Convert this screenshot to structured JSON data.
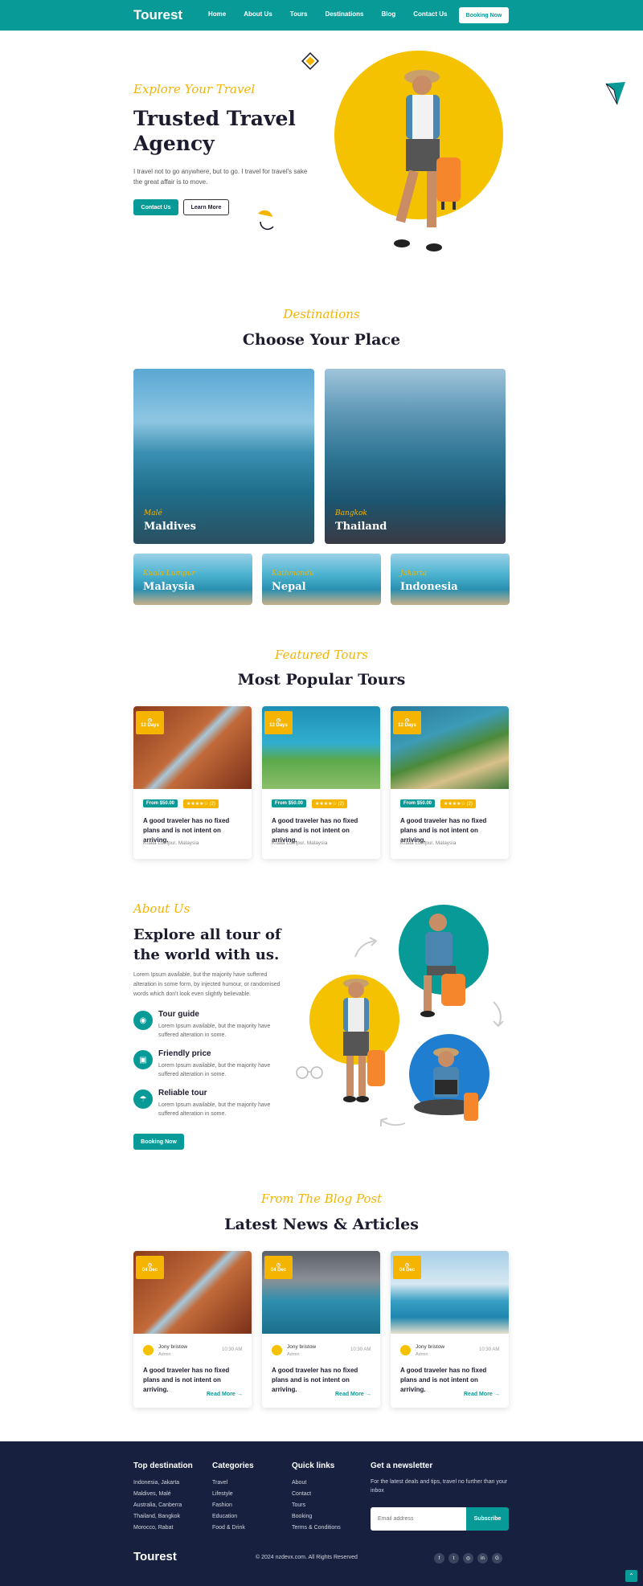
{
  "header": {
    "logo": "Tourest",
    "nav": [
      "Home",
      "About Us",
      "Tours",
      "Destinations",
      "Blog",
      "Contact Us"
    ],
    "cta": "Booking Now"
  },
  "hero": {
    "tagline": "Explore Your Travel",
    "title": "Trusted Travel Agency",
    "description": "I travel not to go anywhere, but to go. I travel for travel's sake the great affair is to move.",
    "btn_primary": "Contact Us",
    "btn_secondary": "Learn More"
  },
  "destinations": {
    "tagline": "Destinations",
    "title": "Choose Your Place",
    "items": [
      {
        "sub": "Malé",
        "name": "Maldives"
      },
      {
        "sub": "Bangkok",
        "name": "Thailand"
      },
      {
        "sub": "Kuala Lumpur",
        "name": "Malaysia"
      },
      {
        "sub": "Kathmandu",
        "name": "Nepal"
      },
      {
        "sub": "Jakarta",
        "name": "Indonesia"
      }
    ]
  },
  "tours": {
    "tagline": "Featured Tours",
    "title": "Most Popular Tours",
    "items": [
      {
        "days": "12 Days",
        "price": "From $50.00",
        "rating": "★★★★☆ (2)",
        "title": "A good traveler has no fixed plans and is not intent on arriving.",
        "location": "Kuala Lumpur, Malaysia"
      },
      {
        "days": "12 Days",
        "price": "From $50.00",
        "rating": "★★★★☆ (2)",
        "title": "A good traveler has no fixed plans and is not intent on arriving.",
        "location": "Kuala Lumpur, Malaysia"
      },
      {
        "days": "12 Days",
        "price": "From $50.00",
        "rating": "★★★★☆ (2)",
        "title": "A good traveler has no fixed plans and is not intent on arriving.",
        "location": "Kuala Lumpur, Malaysia"
      }
    ]
  },
  "about": {
    "tagline": "About Us",
    "title": "Explore all tour of the world with us.",
    "description": "Lorem Ipsum available, but the majority have suffered alteration in some form, by injected humour, or randomised words which don't look even slightly believable.",
    "features": [
      {
        "icon": "compass-icon",
        "title": "Tour guide",
        "desc": "Lorem Ipsum available, but the majority have suffered alteration in some."
      },
      {
        "icon": "briefcase-icon",
        "title": "Friendly price",
        "desc": "Lorem Ipsum available, but the majority have suffered alteration in some."
      },
      {
        "icon": "umbrella-icon",
        "title": "Reliable tour",
        "desc": "Lorem Ipsum available, but the majority have suffered alteration in some."
      }
    ],
    "cta": "Booking Now"
  },
  "blog": {
    "tagline": "From The Blog Post",
    "title": "Latest News & Articles",
    "items": [
      {
        "date": "04 Dec",
        "author": "Jony bristow",
        "role": "Admin",
        "time": "10:30 AM",
        "title": "A good traveler has no fixed plans and is not intent on arriving.",
        "link": "Read More"
      },
      {
        "date": "04 Dec",
        "author": "Jony bristow",
        "role": "Admin",
        "time": "10:30 AM",
        "title": "A good traveler has no fixed plans and is not intent on arriving.",
        "link": "Read More"
      },
      {
        "date": "04 Dec",
        "author": "Jony bristow",
        "role": "Admin",
        "time": "10:30 AM",
        "title": "A good traveler has no fixed plans and is not intent on arriving.",
        "link": "Read More"
      }
    ]
  },
  "footer": {
    "top_destination": {
      "title": "Top destination",
      "items": [
        "Indonesia, Jakarta",
        "Maldives, Malé",
        "Australia, Canberra",
        "Thailand, Bangkok",
        "Morocco, Rabat"
      ]
    },
    "categories": {
      "title": "Categories",
      "items": [
        "Travel",
        "Lifestyle",
        "Fashion",
        "Education",
        "Food & Drink"
      ]
    },
    "quick_links": {
      "title": "Quick links",
      "items": [
        "About",
        "Contact",
        "Tours",
        "Booking",
        "Terms & Conditions"
      ]
    },
    "newsletter": {
      "title": "Get a newsletter",
      "desc": "For the latest deals and tips, travel no further than your inbox",
      "placeholder": "Email address",
      "button": "Subscribe"
    },
    "logo": "Tourest",
    "copyright": "© 2024 nzdevx.com. All Rights Reserved",
    "socials": [
      "facebook-icon",
      "twitter-icon",
      "instagram-icon",
      "linkedin-icon",
      "google-icon"
    ]
  },
  "colors": {
    "primary": "#079a96",
    "accent": "#f4b400",
    "dark": "#17213f"
  }
}
